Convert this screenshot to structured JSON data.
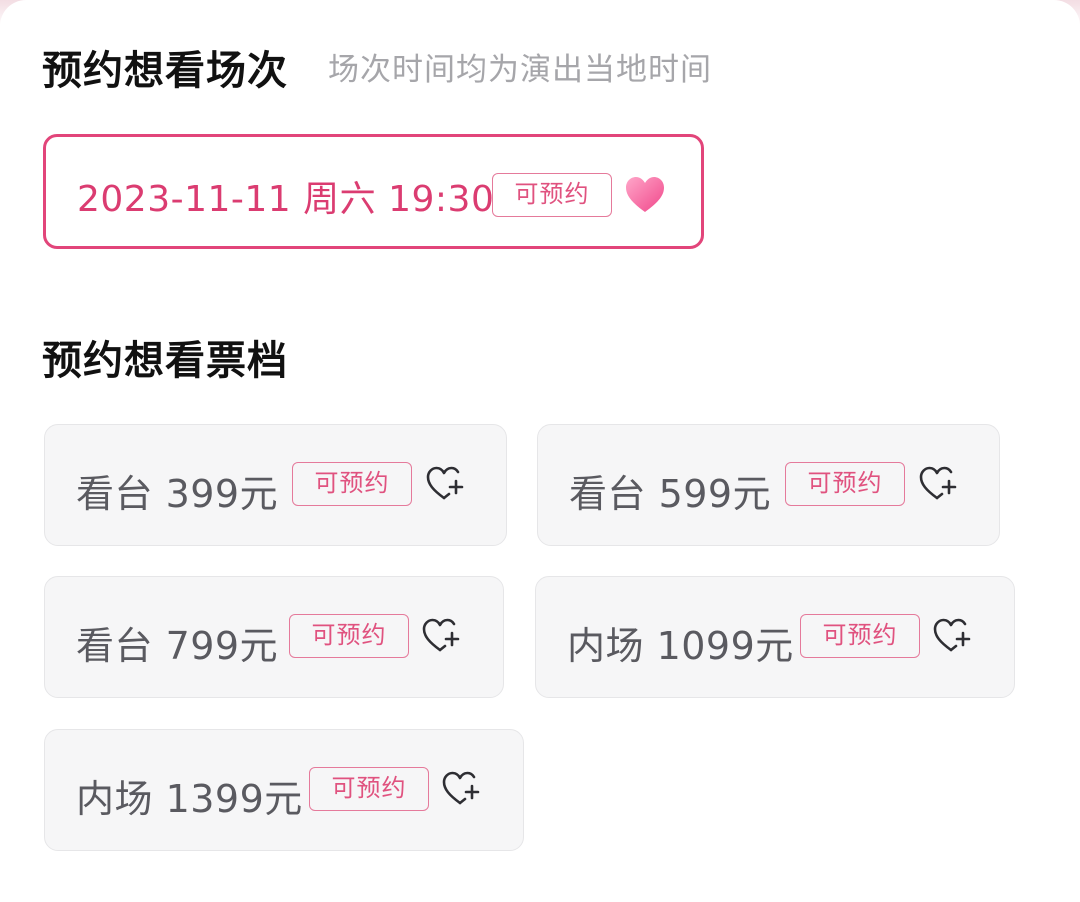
{
  "session_section": {
    "title": "预约想看场次",
    "note": "场次时间均为演出当地时间",
    "session": {
      "date_time": "2023-11-11 周六 19:30",
      "status": "可预约",
      "icon": "heart-filled-icon",
      "selected": true
    }
  },
  "tier_section": {
    "title": "预约想看票档",
    "tiers": [
      {
        "label": "看台 399元",
        "status": "可预约",
        "icon": "heart-plus-icon"
      },
      {
        "label": "看台 599元",
        "status": "可预约",
        "icon": "heart-plus-icon"
      },
      {
        "label": "看台 799元",
        "status": "可预约",
        "icon": "heart-plus-icon"
      },
      {
        "label": "内场 1099元",
        "status": "可预约",
        "icon": "heart-plus-icon"
      },
      {
        "label": "内场 1399元",
        "status": "可预约",
        "icon": "heart-plus-icon"
      }
    ]
  },
  "colors": {
    "accent": "#e2457a",
    "badge_border": "#e57a9b",
    "card_bg": "#f6f6f7",
    "muted_text": "#a6a6aa"
  }
}
